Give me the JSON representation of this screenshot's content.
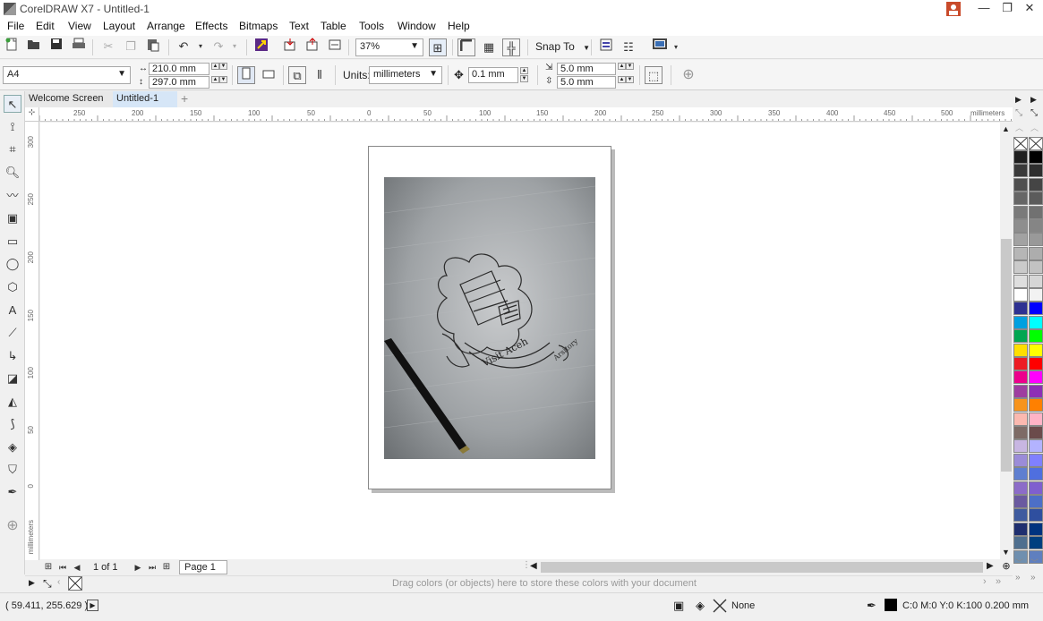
{
  "window": {
    "title": "CorelDRAW X7 - Untitled-1",
    "controls": {
      "minimize": "—",
      "restore": "❐",
      "close": "✕"
    }
  },
  "menu": [
    "File",
    "Edit",
    "View",
    "Layout",
    "Arrange",
    "Effects",
    "Bitmaps",
    "Text",
    "Table",
    "Tools",
    "Window",
    "Help"
  ],
  "toolbar": {
    "zoom": "37%",
    "snap_to": "Snap To"
  },
  "property_bar": {
    "page_size": "A4",
    "width": "210.0 mm",
    "height": "297.0 mm",
    "units_label": "Units:",
    "units": "millimeters",
    "nudge": "0.1 mm",
    "dup_x": "5.0 mm",
    "dup_y": "5.0 mm"
  },
  "tabs": [
    {
      "label": "Welcome Screen"
    },
    {
      "label": "Untitled-1"
    },
    {
      "label": "+"
    }
  ],
  "rulers": {
    "h_ticks": [
      "250",
      "200",
      "150",
      "100",
      "50",
      "0",
      "50",
      "100",
      "150",
      "200",
      "250",
      "300",
      "350",
      "400",
      "450",
      "500"
    ],
    "h_unit": "millimeters",
    "v_ticks": [
      "300",
      "250",
      "200",
      "150",
      "100",
      "50",
      "0"
    ],
    "v_unit": "millimeters"
  },
  "page_nav": {
    "page_count": "1 of 1",
    "page_tab": "Page 1"
  },
  "document_palette": {
    "hint": "Drag colors (or objects) here to store these colors with your document"
  },
  "status": {
    "coords": "( 59.411, 255.629 )",
    "fill": "None",
    "outline": "C:0 M:0 Y:0 K:100  0.200 mm"
  },
  "palette_colors": [
    [
      "#1f1f1f",
      "#000000"
    ],
    [
      "#3a3a3a",
      "#2f2f2f"
    ],
    [
      "#4f4f4f",
      "#454545"
    ],
    [
      "#666666",
      "#5b5b5b"
    ],
    [
      "#7a7a7a",
      "#717171"
    ],
    [
      "#8e8e8e",
      "#858585"
    ],
    [
      "#a2a2a2",
      "#999999"
    ],
    [
      "#b6b6b6",
      "#adadad"
    ],
    [
      "#cacaca",
      "#c2c2c2"
    ],
    [
      "#dedede",
      "#d6d6d6"
    ],
    [
      "#ffffff",
      "#f2f2f2"
    ],
    [
      "#2e3192",
      "#0000ff"
    ],
    [
      "#00a0e0",
      "#00ffff"
    ],
    [
      "#00a651",
      "#00ff00"
    ],
    [
      "#ffde00",
      "#ffff00"
    ],
    [
      "#ed1c24",
      "#ff0000"
    ],
    [
      "#ec008c",
      "#ff00ff"
    ],
    [
      "#9e3ea0",
      "#8e2fb6"
    ],
    [
      "#f7941d",
      "#ff8000"
    ],
    [
      "#fbb9b0",
      "#ffb3c6"
    ],
    [
      "#7d6b66",
      "#6b4b4b"
    ],
    [
      "#c8b6e2",
      "#b3b3ff"
    ],
    [
      "#9b8cd8",
      "#8080ff"
    ],
    [
      "#5f7fd0",
      "#4f6fdf"
    ],
    [
      "#8c6cc8",
      "#7f5fcf"
    ],
    [
      "#6a5aa0",
      "#4d6fc7"
    ],
    [
      "#3f5b9f",
      "#2f4f9f"
    ],
    [
      "#1f2f6f",
      "#00337f"
    ],
    [
      "#4f6f8f",
      "#003f7f"
    ],
    [
      "#6f8faf",
      "#5f7fbf"
    ]
  ]
}
